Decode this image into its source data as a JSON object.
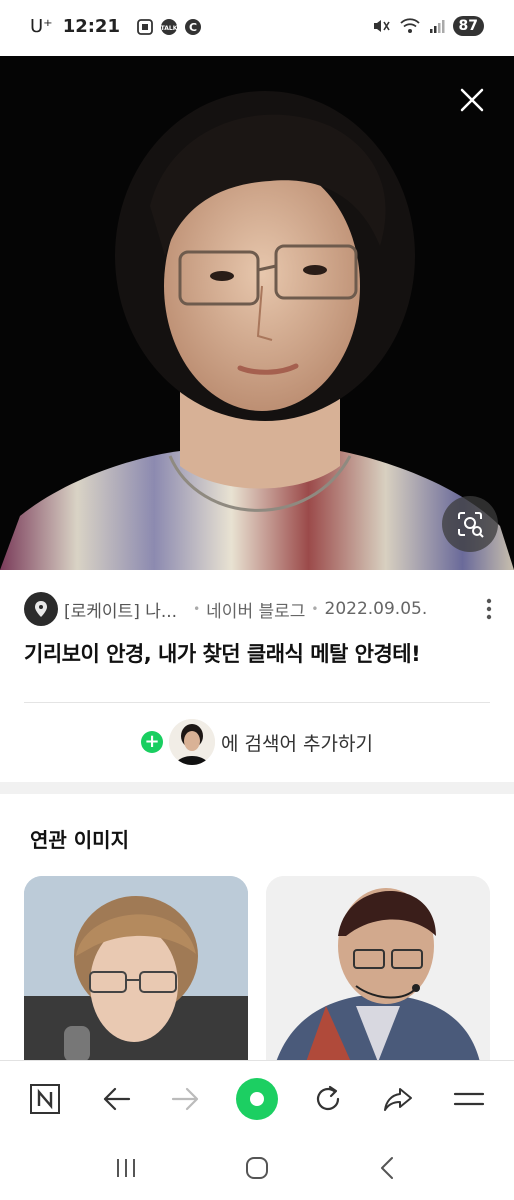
{
  "status_bar": {
    "carrier": "U⁺",
    "time": "12:21",
    "battery": "87",
    "left_icons": [
      "screenshot-icon",
      "talk-icon",
      "c-icon"
    ],
    "right_icons": [
      "mute-icon",
      "wifi-icon",
      "signal-icon"
    ]
  },
  "hero": {
    "close_icon": "close-icon",
    "lens_icon": "image-search-icon"
  },
  "source": {
    "name": "[로케이트] 나...",
    "site": "네이버 블로그",
    "date": "2022.09.05."
  },
  "title": "기리보이 안경, 내가 찾던 클래식 메탈 안경테!",
  "add_search": {
    "label": "에 검색어 추가하기"
  },
  "related": {
    "heading": "연관 이미지"
  },
  "colors": {
    "accent_green": "#19ce60",
    "text_primary": "#111111",
    "text_secondary": "#666666"
  },
  "toolbar": {
    "icons": [
      "naver-n-icon",
      "back-arrow-icon",
      "forward-arrow-icon",
      "green-dot-icon",
      "refresh-icon",
      "share-icon",
      "menu-icon"
    ]
  },
  "system_nav": {
    "icons": [
      "recents-icon",
      "home-icon",
      "back-icon"
    ]
  }
}
